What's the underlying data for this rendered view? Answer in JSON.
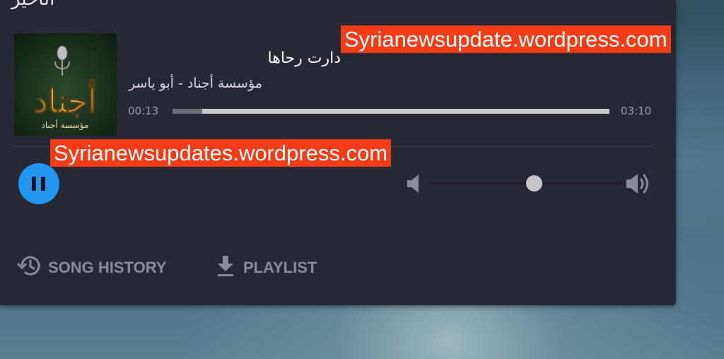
{
  "window": {
    "top_title_fragment": "الأخير"
  },
  "track": {
    "title": "دارت رحاها",
    "artist": "مؤسسة أجناد - أبو ياسر",
    "album_art": {
      "logo_text": "أجناد",
      "caption": "مؤسسة أجناد"
    }
  },
  "progress": {
    "elapsed": "00:13",
    "total": "03:10",
    "fraction": 0.068
  },
  "controls": {
    "play_state": "playing",
    "pause_icon": "pause-icon",
    "volume_low_icon": "volume-low-icon",
    "volume_high_icon": "volume-high-icon",
    "volume_level": 0.54
  },
  "actions": [
    {
      "label": "SONG HISTORY",
      "icon": "history-icon"
    },
    {
      "label": "PLAYLIST",
      "icon": "download-icon"
    }
  ],
  "watermarks": [
    "Syrianewsupdate.wordpress.com",
    "Syrianewsupdates.wordpress.com"
  ],
  "colors": {
    "panel": "#262834",
    "accent": "#2196f3",
    "watermark_bg": "#f23c18"
  }
}
